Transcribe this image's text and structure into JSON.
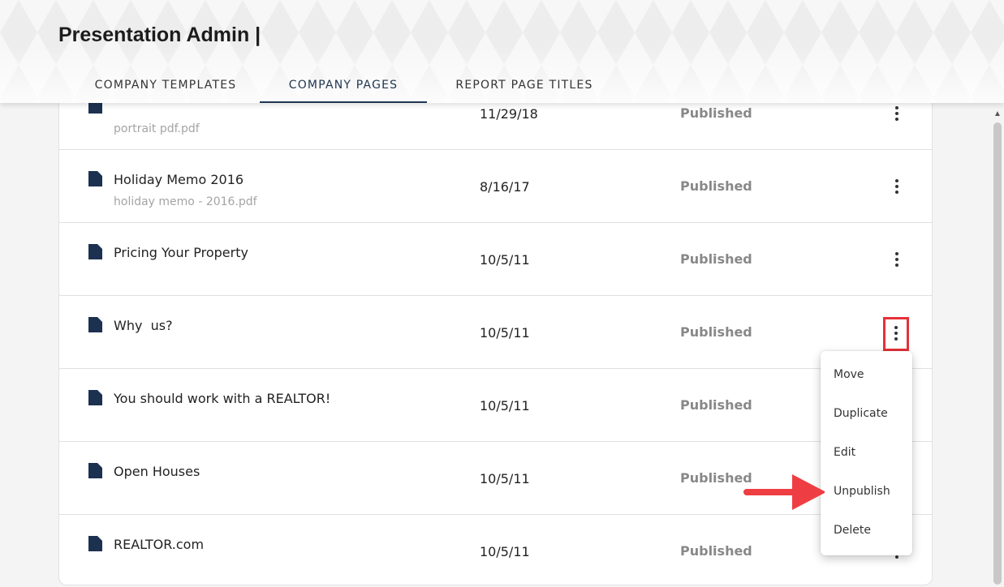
{
  "app": {
    "title": "Presentation Admin |"
  },
  "tabs": [
    {
      "label": "COMPANY TEMPLATES",
      "active": false
    },
    {
      "label": "COMPANY PAGES",
      "active": true
    },
    {
      "label": "REPORT PAGE TITLES",
      "active": false
    }
  ],
  "rows": [
    {
      "title": "",
      "subtitle": "portrait pdf.pdf",
      "date": "11/29/18",
      "status": "Published"
    },
    {
      "title": "Holiday Memo 2016",
      "subtitle": "holiday memo - 2016.pdf",
      "date": "8/16/17",
      "status": "Published"
    },
    {
      "title": "Pricing Your Property",
      "subtitle": "",
      "date": "10/5/11",
      "status": "Published"
    },
    {
      "title": "Why  us?",
      "subtitle": "",
      "date": "10/5/11",
      "status": "Published"
    },
    {
      "title": "You should work with a REALTOR!",
      "subtitle": "",
      "date": "10/5/11",
      "status": "Published"
    },
    {
      "title": "Open Houses",
      "subtitle": "",
      "date": "10/5/11",
      "status": "Published"
    },
    {
      "title": "REALTOR.com",
      "subtitle": "",
      "date": "10/5/11",
      "status": "Published"
    }
  ],
  "menu": {
    "items": [
      {
        "label": "Move"
      },
      {
        "label": "Duplicate"
      },
      {
        "label": "Edit"
      },
      {
        "label": "Unpublish"
      },
      {
        "label": "Delete"
      }
    ]
  },
  "colors": {
    "accent": "#1f3550",
    "doc_icon": "#1c3150",
    "highlight": "#e53238",
    "arrow": "#ef3e43"
  },
  "icons": {
    "document": "document-icon",
    "more": "more-vertical-icon",
    "arrow": "arrow-right-icon"
  }
}
